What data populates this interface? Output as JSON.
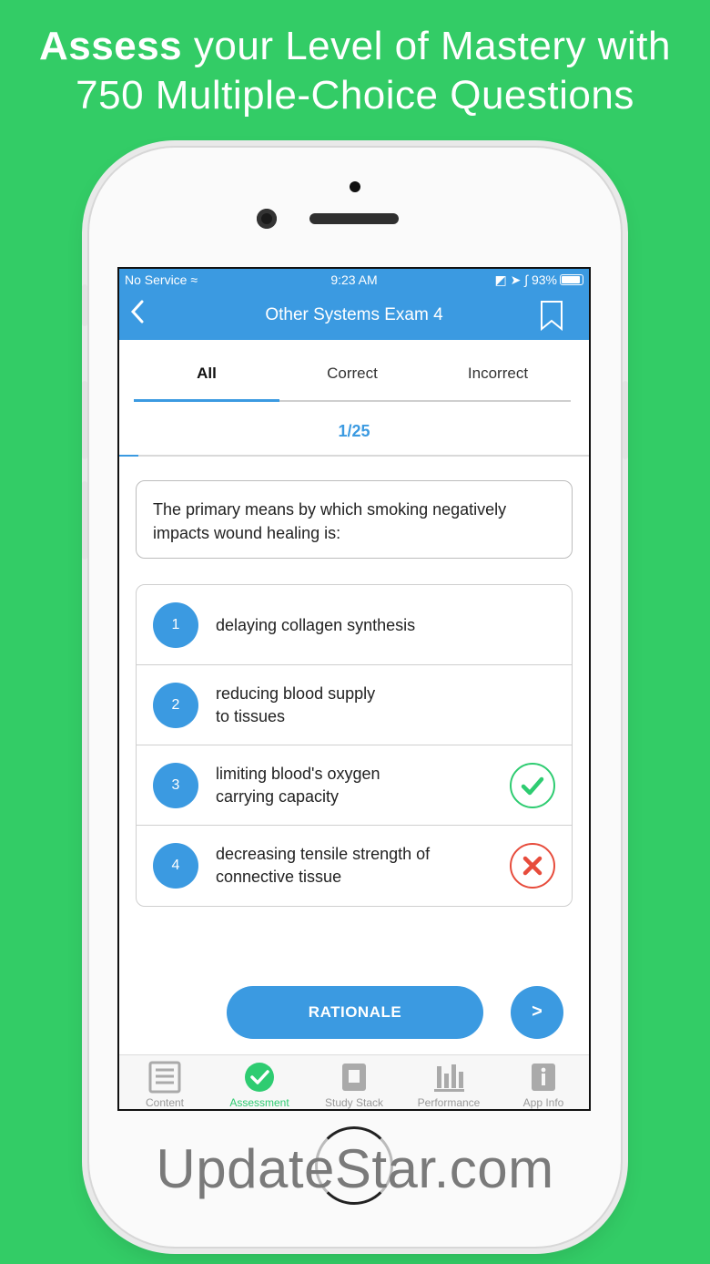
{
  "promo": {
    "headline_bold": "Assess",
    "headline_rest": " your Level of Mastery with",
    "headline_line2": "750 Multiple-Choice Questions"
  },
  "status_bar": {
    "carrier": "No Service",
    "time": "9:23 AM",
    "battery": "93%"
  },
  "navbar": {
    "title": "Other Systems Exam 4",
    "back_icon": "chevron-left-icon",
    "bookmark_icon": "bookmark-icon"
  },
  "tabs": [
    {
      "label": "All",
      "active": true
    },
    {
      "label": "Correct",
      "active": false
    },
    {
      "label": "Incorrect",
      "active": false
    }
  ],
  "progress": {
    "counter": "1/25",
    "fraction": 0.04
  },
  "question": {
    "text": "The primary means by which smoking negatively impacts wound healing is:"
  },
  "answers": [
    {
      "number": "1",
      "text": "delaying collagen synthesis",
      "status": "none"
    },
    {
      "number": "2",
      "text": "reducing blood supply\nto tissues",
      "status": "none"
    },
    {
      "number": "3",
      "text": "limiting blood's oxygen\ncarrying capacity",
      "status": "correct"
    },
    {
      "number": "4",
      "text": "decreasing tensile strength of\nconnective tissue",
      "status": "wrong"
    }
  ],
  "actions": {
    "rationale_label": "RATIONALE",
    "next_label": ">"
  },
  "tabbar": [
    {
      "label": "Content",
      "icon": "list-icon",
      "active": false
    },
    {
      "label": "Assessment",
      "icon": "check-circle-icon",
      "active": true
    },
    {
      "label": "Study Stack",
      "icon": "book-icon",
      "active": false
    },
    {
      "label": "Performance",
      "icon": "bar-chart-icon",
      "active": false
    },
    {
      "label": "App Info",
      "icon": "info-book-icon",
      "active": false
    }
  ],
  "colors": {
    "background": "#33cc66",
    "accent": "#3b9ae1",
    "correct": "#2ecc71",
    "wrong": "#e74c3c"
  },
  "watermark": "UpdateStar.com"
}
